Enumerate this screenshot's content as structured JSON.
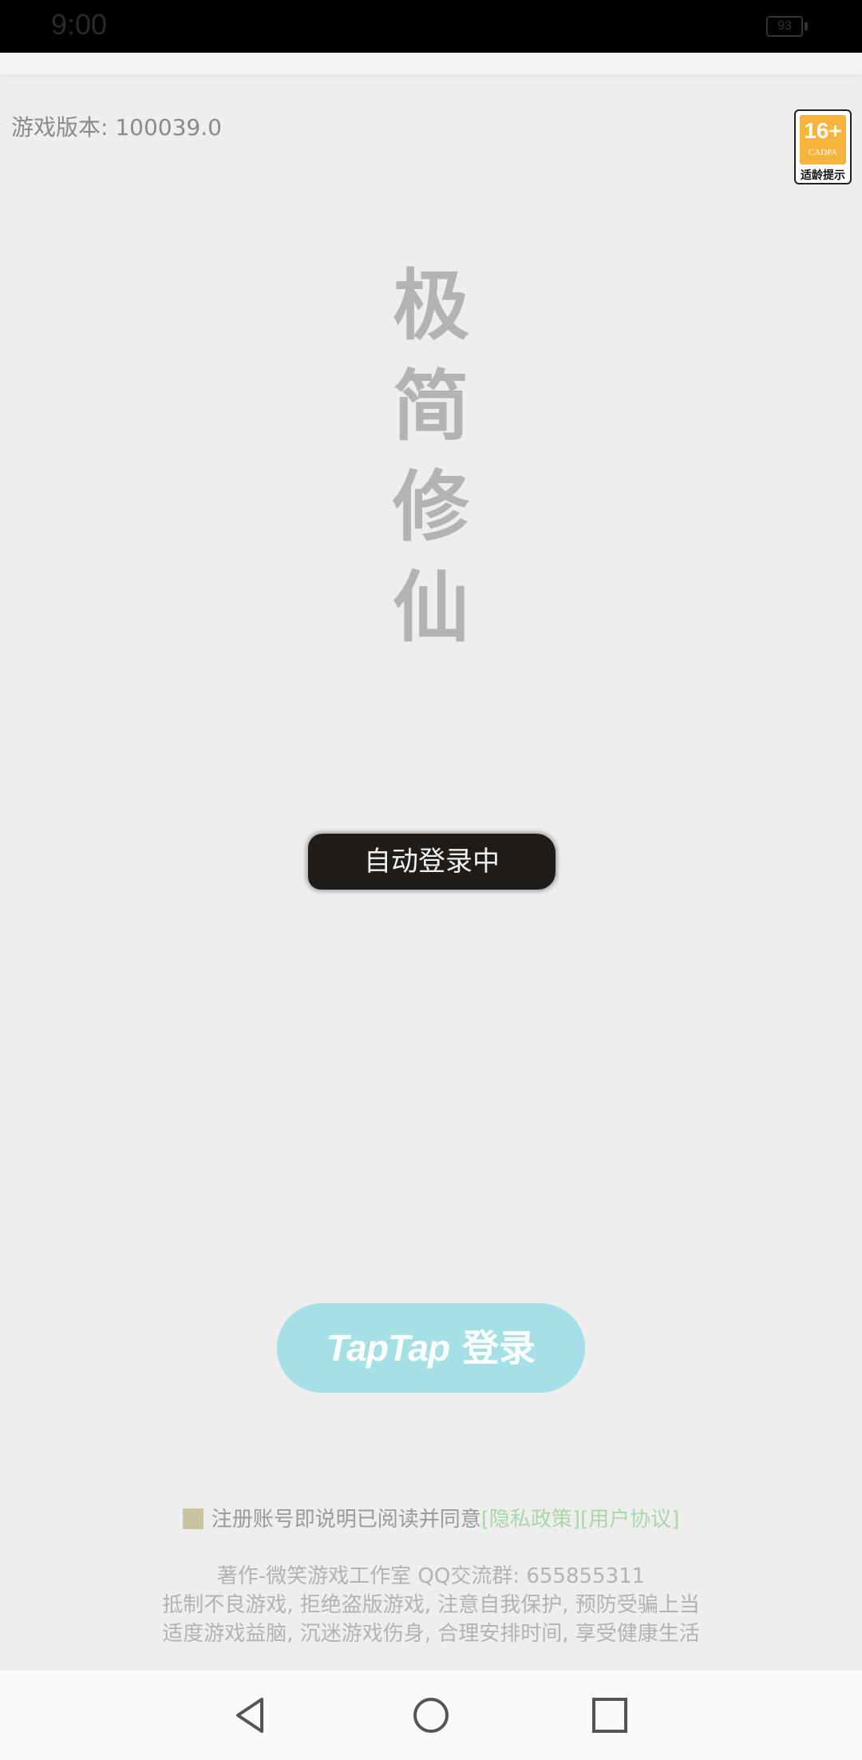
{
  "status_bar": {
    "time": "9:00",
    "battery": "93"
  },
  "version_label": "游戏版本: 100039.0",
  "age_rating": {
    "age": "16+",
    "org": "CADPA",
    "hint": "适龄提示"
  },
  "game_title": "极简修仙",
  "auto_login_text": "自动登录中",
  "login_button": {
    "brand": "TapTap",
    "label": "登录"
  },
  "agreement": {
    "text": "注册账号即说明已阅读并同意",
    "privacy_link": "[隐私政策]",
    "user_link": "[用户协议]"
  },
  "footer": {
    "credits": "著作-微笑游戏工作室   QQ交流群: 655855311",
    "notice_line1": "抵制不良游戏, 拒绝盗版游戏, 注意自我保护, 预防受骗上当",
    "notice_line2": "适度游戏益脑, 沉迷游戏伤身, 合理安排时间, 享受健康生活"
  },
  "nav_bar": {
    "icons": [
      "back-icon",
      "home-icon",
      "recents-icon"
    ]
  }
}
